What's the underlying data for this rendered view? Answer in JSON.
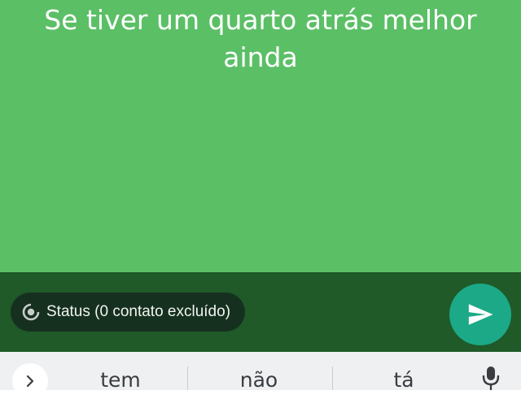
{
  "status": {
    "text": "Se tiver um quarto atrás melhor ainda",
    "background_color": "#5bbf66"
  },
  "composer": {
    "audience_label": "Status (0 contato excluído)",
    "audience_icon": "status-icon",
    "send_icon": "send-icon",
    "send_color": "#1ba987",
    "bar_color": "#1f5a28"
  },
  "keyboard": {
    "suggestions": [
      "tem",
      "não",
      "tá"
    ],
    "expand_icon": "chevron-right-icon",
    "mic_icon": "microphone-icon"
  }
}
